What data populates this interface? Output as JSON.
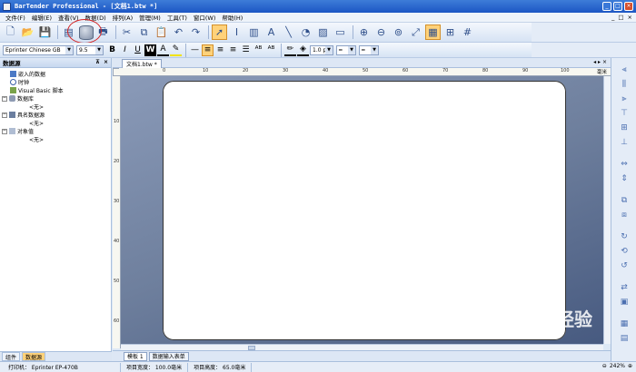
{
  "titlebar": {
    "title": "BarTender Professional - [文档1.btw *]",
    "minimize": "_",
    "maximize": "□",
    "close": "×"
  },
  "menu": {
    "items": [
      "文件(F)",
      "编辑(E)",
      "查看(V)",
      "数据(D)",
      "排列(A)",
      "管理(M)",
      "工具(T)",
      "窗口(W)",
      "帮助(H)"
    ],
    "right": [
      "_",
      "□",
      "×"
    ]
  },
  "format_bar": {
    "font_name": "Eprinter Chinese GB",
    "font_size": "9.5",
    "line_width": "1.0 pt"
  },
  "left_panel": {
    "title": "数据源",
    "tree": [
      {
        "label": "嵌入的数据",
        "level": 0
      },
      {
        "label": "时钟",
        "level": 0
      },
      {
        "label": "Visual Basic 脚本",
        "level": 0
      },
      {
        "label": "数据库",
        "level": 0,
        "toggle": "⊟"
      },
      {
        "label": "<无>",
        "level": 1
      },
      {
        "label": "具名数据源",
        "level": 0,
        "toggle": "⊟"
      },
      {
        "label": "<无>",
        "level": 1
      },
      {
        "label": "对象值",
        "level": 0,
        "toggle": "⊟"
      },
      {
        "label": "<无>",
        "level": 1
      }
    ],
    "tabs": [
      "组件",
      "数据源"
    ]
  },
  "document": {
    "tab": "文档1.btw *",
    "ruler_unit": "毫米",
    "h_ticks": [
      "0",
      "10",
      "20",
      "30",
      "40",
      "50",
      "60",
      "70",
      "80",
      "90",
      "100"
    ],
    "v_ticks": [
      "10",
      "20",
      "30",
      "40",
      "50",
      "60"
    ],
    "sheet_tabs": [
      "模板 1",
      "数据输入表单"
    ]
  },
  "status": {
    "printer": "打印机：  Eprinter EP-470B",
    "item_width": "项目宽度：  100.0毫米",
    "item_height": "项目高度：  65.0毫米",
    "zoom": "242%"
  },
  "watermark": {
    "text": "Bai 经验"
  }
}
